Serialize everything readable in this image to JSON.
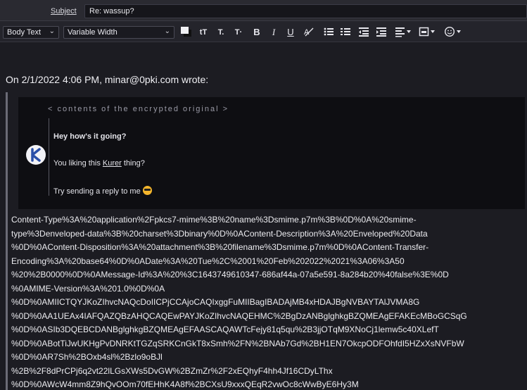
{
  "header": {
    "subject_label": "Subject",
    "subject_value": "Re: wassup?"
  },
  "toolbar": {
    "paragraph_style": "Body Text",
    "font_family": "Variable Width",
    "bold": "B",
    "italic": "I",
    "underline": "U"
  },
  "message": {
    "attribution": "On 2/1/2022 4:06 PM, minar@0pki.com wrote:",
    "encrypted_title": "< contents of the encrypted original >",
    "greeting": "Hey how's it going?",
    "line2_prefix": "You liking this ",
    "line2_link": "Kurer",
    "line2_suffix": " thing?",
    "line3": "Try sending a reply to me",
    "raw_lines": [
      "Content-Type%3A%20application%2Fpkcs7-mime%3B%20name%3Dsmime.p7m%3B%0D%0A%20smime-",
      "type%3Denveloped-data%3B%20charset%3Dbinary%0D%0AContent-Description%3A%20Enveloped%20Data",
      "%0D%0AContent-Disposition%3A%20attachment%3B%20filename%3Dsmime.p7m%0D%0AContent-Transfer-",
      "Encoding%3A%20base64%0D%0ADate%3A%20Tue%2C%2001%20Feb%202022%2021%3A06%3A50",
      "%20%2B0000%0D%0AMessage-Id%3A%20%3C1643749610347-686af44a-07a5e591-8a284b20%40false%3E%0D",
      "%0AMIME-Version%3A%201.0%0D%0A",
      "%0D%0AMIICTQYJKoZIhvcNAQcDoIICPjCCAjoCAQIxggFuMIIBagIBADAjMB4xHDAJBgNVBAYTAlJVMA8G",
      "%0D%0AA1UEAx4IAFQAZQBzAHQCAQEwPAYJKoZIhvcNAQEHMC%2BgDzANBglghkgBZQMEAgEFAKEcMBoGCSqG",
      "%0D%0ASIb3DQEBCDANBglghkgBZQMEAgEFAASCAQAWTcFejy81q5qu%2B3jjOTqM9XNoCj1lemw5c40XLefT",
      "%0D%0ABotTiJwUKHgPvDNRKtTGZqSRKCnGkT8xSmh%2FN%2BNAb7Gd%2BH1EN7OkcpODFOhfdI5HZxXsNVFbW",
      "%0D%0AR7Sh%2BOxb4sl%2Bzlo9oBJl",
      "%2B%2F8dPrCPj6q2vt22lLGsXWs5DvGW%2BZmZr%2F2xEQhyF4hh4Jf16CDyLThx",
      "%0D%0AWcW4mm8Z9hQvOOm70fEHhK4A8f%2BCXsU9xxxQEqR2vwOc8cWwByE6Hy3M"
    ]
  }
}
